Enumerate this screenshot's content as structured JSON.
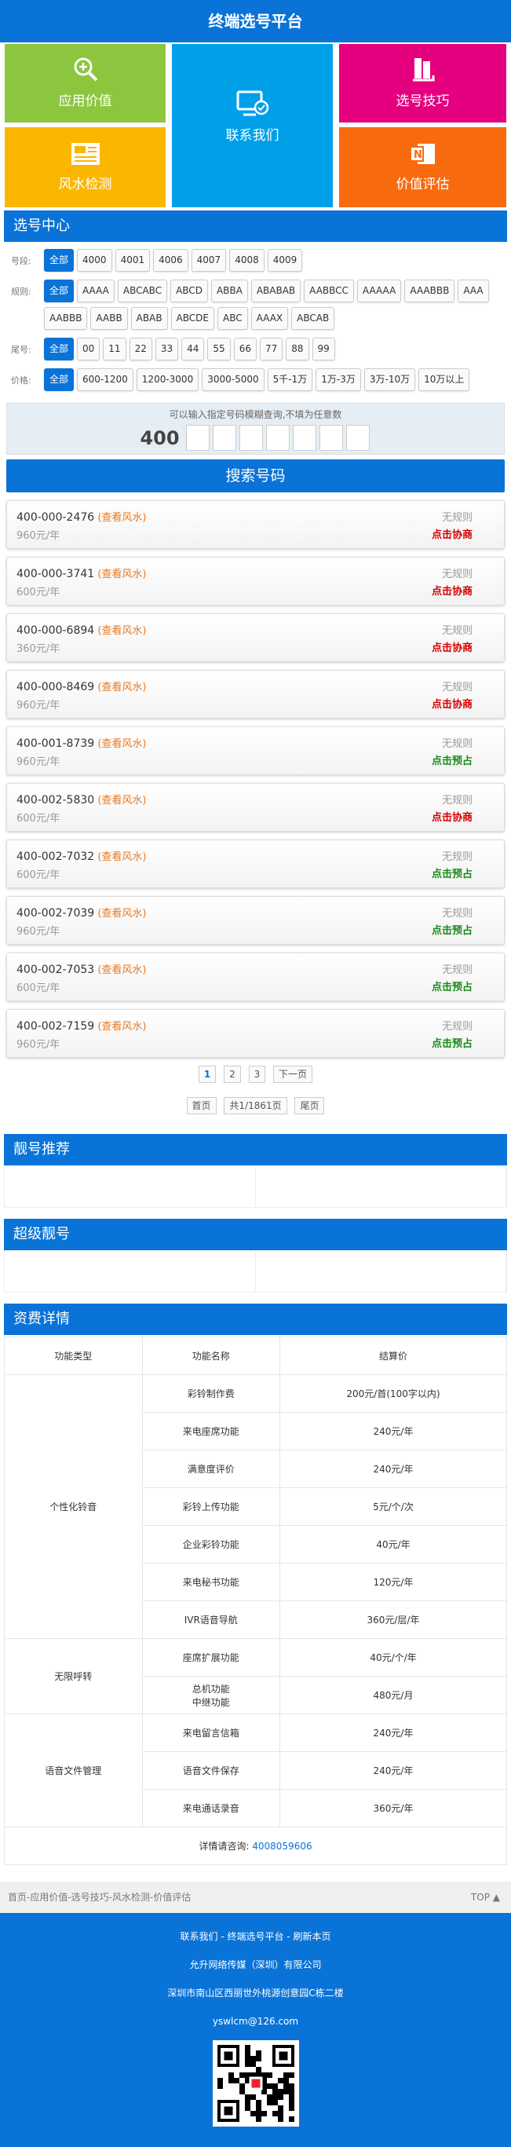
{
  "app": {
    "title": "终端选号平台"
  },
  "tiles": [
    {
      "label": "应用价值",
      "color": "#8cc63f",
      "icon": "magnifier-plus-icon"
    },
    {
      "label": "联系我们",
      "color": "#00a0e9",
      "icon": "contact-display-icon"
    },
    {
      "label": "选号技巧",
      "color": "#e4007f",
      "icon": "book-icon"
    },
    {
      "label": "风水检测",
      "color": "#fbb600",
      "icon": "newspaper-icon"
    },
    {
      "label": "价值评估",
      "color": "#f86a0e",
      "icon": "note-icon"
    }
  ],
  "select_center": {
    "title": "选号中心",
    "rows": [
      {
        "label": "号段:",
        "chips": [
          "全部",
          "4000",
          "4001",
          "4006",
          "4007",
          "4008",
          "4009"
        ]
      },
      {
        "label": "规则:",
        "chips": [
          "全部",
          "AAAA",
          "ABCABC",
          "ABCD",
          "ABBA",
          "ABABAB",
          "AABBCC",
          "AAAAA",
          "AAABBB",
          "AAA",
          "AABBB",
          "AABB",
          "ABAB",
          "ABCDE",
          "ABC",
          "AAAX",
          "ABCAB"
        ]
      },
      {
        "label": "尾号:",
        "chips": [
          "全部",
          "00",
          "11",
          "22",
          "33",
          "44",
          "55",
          "66",
          "77",
          "88",
          "99"
        ]
      },
      {
        "label": "价格:",
        "chips": [
          "全部",
          "600-1200",
          "1200-3000",
          "3000-5000",
          "5千-1万",
          "1万-3万",
          "3万-10万",
          "10万以上"
        ]
      }
    ],
    "hint": "可以输入指定号码模糊查询,不填为任意数",
    "prefix": "400",
    "search_button": "搜索号码"
  },
  "numbers": [
    {
      "num": "400-000-2476",
      "fs": "(查看风水)",
      "price": "960元/年",
      "rule": "无规则",
      "act": "点击协商",
      "act_color": "red"
    },
    {
      "num": "400-000-3741",
      "fs": "(查看风水)",
      "price": "600元/年",
      "rule": "无规则",
      "act": "点击协商",
      "act_color": "red"
    },
    {
      "num": "400-000-6894",
      "fs": "(查看风水)",
      "price": "360元/年",
      "rule": "无规则",
      "act": "点击协商",
      "act_color": "red"
    },
    {
      "num": "400-000-8469",
      "fs": "(查看风水)",
      "price": "960元/年",
      "rule": "无规则",
      "act": "点击协商",
      "act_color": "red"
    },
    {
      "num": "400-001-8739",
      "fs": "(查看风水)",
      "price": "960元/年",
      "rule": "无规则",
      "act": "点击预占",
      "act_color": "green"
    },
    {
      "num": "400-002-5830",
      "fs": "(查看风水)",
      "price": "600元/年",
      "rule": "无规则",
      "act": "点击协商",
      "act_color": "red"
    },
    {
      "num": "400-002-7032",
      "fs": "(查看风水)",
      "price": "600元/年",
      "rule": "无规则",
      "act": "点击预占",
      "act_color": "green"
    },
    {
      "num": "400-002-7039",
      "fs": "(查看风水)",
      "price": "960元/年",
      "rule": "无规则",
      "act": "点击预占",
      "act_color": "green"
    },
    {
      "num": "400-002-7053",
      "fs": "(查看风水)",
      "price": "600元/年",
      "rule": "无规则",
      "act": "点击预占",
      "act_color": "green"
    },
    {
      "num": "400-002-7159",
      "fs": "(查看风水)",
      "price": "960元/年",
      "rule": "无规则",
      "act": "点击预占",
      "act_color": "green"
    }
  ],
  "pager": {
    "pages": [
      "1",
      "2",
      "3"
    ],
    "next": "下一页",
    "first": "首页",
    "info": "共1/1861页",
    "last": "尾页"
  },
  "recommend": {
    "title": "靓号推荐"
  },
  "super": {
    "title": "超级靓号"
  },
  "fees": {
    "title": "资费详情",
    "headers": [
      "功能类型",
      "功能名称",
      "结算价"
    ],
    "groups": [
      {
        "type": "个性化铃音",
        "rows": [
          [
            "彩铃制作费",
            "200元/首(100字以内)"
          ],
          [
            "来电座席功能",
            "240元/年"
          ],
          [
            "满意度评价",
            "240元/年"
          ],
          [
            "彩铃上传功能",
            "5元/个/次"
          ],
          [
            "企业彩铃功能",
            "40元/年"
          ],
          [
            "来电秘书功能",
            "120元/年"
          ],
          [
            "IVR语音导航",
            "360元/层/年"
          ]
        ]
      },
      {
        "type": "无限呼转",
        "rows": [
          [
            "座席扩展功能",
            "40元/个/年"
          ],
          [
            "总机功能\n中继功能",
            "480元/月"
          ]
        ]
      },
      {
        "type": "语音文件管理",
        "rows": [
          [
            "来电留言信箱",
            "240元/年"
          ],
          [
            "语音文件保存",
            "240元/年"
          ],
          [
            "来电通话录音",
            "360元/年"
          ]
        ]
      }
    ],
    "consult_label": "详情请咨询:",
    "consult_phone": "4008059606"
  },
  "breadcrumb": {
    "text": "首页-应用价值-选号技巧-风水检测-价值评估",
    "top": "TOP"
  },
  "footer": {
    "links": "联系我们  -  终端选号平台  -  刷新本页",
    "company": "允升网络传媒（深圳）有限公司",
    "address": "深圳市南山区西丽世外桃源创意园C栋二楼",
    "email": "yswlcm@126.com"
  }
}
